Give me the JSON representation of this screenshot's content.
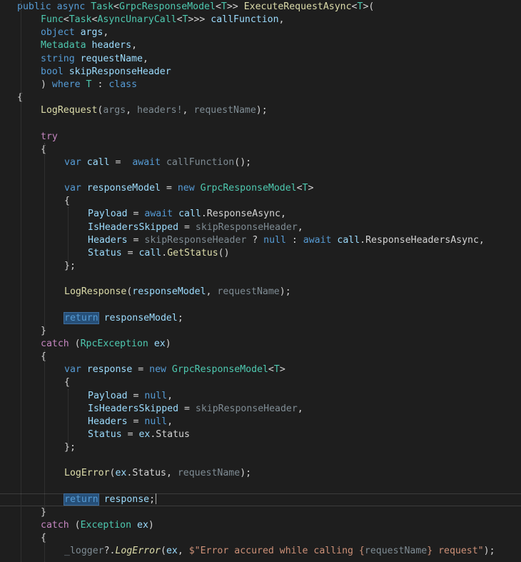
{
  "colors": {
    "background": "#1e1e1e",
    "keyword": "#569cd6",
    "control": "#c586c0",
    "type": "#4ec9b0",
    "method": "#dcdcaa",
    "variable": "#9cdcfe",
    "param_faded": "#7f8c94",
    "text": "#d4d4d4",
    "string": "#ce9178",
    "selection": "#264f78"
  },
  "lines": [
    {
      "indent": 0,
      "tokens": [
        [
          "public",
          "keyword"
        ],
        [
          " ",
          ""
        ],
        [
          "async",
          "keyword"
        ],
        [
          " ",
          ""
        ],
        [
          "Task",
          "type"
        ],
        [
          "<",
          ""
        ],
        [
          "GrpcResponseModel",
          "type"
        ],
        [
          "<",
          ""
        ],
        [
          "T",
          "type"
        ],
        [
          ">> ",
          ""
        ],
        [
          "ExecuteRequestAsync",
          "method"
        ],
        [
          "<",
          ""
        ],
        [
          "T",
          "type"
        ],
        [
          ">(",
          ""
        ]
      ]
    },
    {
      "indent": 1,
      "tokens": [
        [
          "Func",
          "type"
        ],
        [
          "<",
          ""
        ],
        [
          "Task",
          "type"
        ],
        [
          "<",
          ""
        ],
        [
          "AsyncUnaryCall",
          "type"
        ],
        [
          "<",
          ""
        ],
        [
          "T",
          "type"
        ],
        [
          ">>> ",
          ""
        ],
        [
          "callFunction",
          "variable"
        ],
        [
          ",",
          ""
        ]
      ]
    },
    {
      "indent": 1,
      "tokens": [
        [
          "object",
          "keyword"
        ],
        [
          " ",
          ""
        ],
        [
          "args",
          "variable"
        ],
        [
          ",",
          ""
        ]
      ]
    },
    {
      "indent": 1,
      "tokens": [
        [
          "Metadata",
          "type"
        ],
        [
          " ",
          ""
        ],
        [
          "headers",
          "variable"
        ],
        [
          ",",
          ""
        ]
      ]
    },
    {
      "indent": 1,
      "tokens": [
        [
          "string",
          "keyword"
        ],
        [
          " ",
          ""
        ],
        [
          "requestName",
          "variable"
        ],
        [
          ",",
          ""
        ]
      ]
    },
    {
      "indent": 1,
      "tokens": [
        [
          "bool",
          "keyword"
        ],
        [
          " ",
          ""
        ],
        [
          "skipResponseHeader",
          "variable"
        ]
      ]
    },
    {
      "indent": 1,
      "tokens": [
        [
          ") ",
          ""
        ],
        [
          "where",
          "keyword"
        ],
        [
          " ",
          ""
        ],
        [
          "T",
          "type"
        ],
        [
          " : ",
          ""
        ],
        [
          "class",
          "keyword"
        ]
      ]
    },
    {
      "indent": 0,
      "tokens": [
        [
          "{",
          ""
        ]
      ]
    },
    {
      "indent": 1,
      "tokens": [
        [
          "LogRequest",
          "method"
        ],
        [
          "(",
          ""
        ],
        [
          "args",
          "param_faded"
        ],
        [
          ", ",
          ""
        ],
        [
          "headers!",
          "param_faded"
        ],
        [
          ", ",
          ""
        ],
        [
          "requestName",
          "param_faded"
        ],
        [
          ");",
          ""
        ]
      ]
    },
    {
      "indent": 0,
      "tokens": []
    },
    {
      "indent": 1,
      "tokens": [
        [
          "try",
          "control"
        ]
      ]
    },
    {
      "indent": 1,
      "tokens": [
        [
          "{",
          ""
        ]
      ]
    },
    {
      "indent": 2,
      "tokens": [
        [
          "var",
          "keyword"
        ],
        [
          " ",
          ""
        ],
        [
          "call",
          "variable"
        ],
        [
          " =  ",
          ""
        ],
        [
          "await",
          "keyword"
        ],
        [
          " ",
          ""
        ],
        [
          "callFunction",
          "param_faded"
        ],
        [
          "();",
          ""
        ]
      ]
    },
    {
      "indent": 0,
      "tokens": []
    },
    {
      "indent": 2,
      "tokens": [
        [
          "var",
          "keyword"
        ],
        [
          " ",
          ""
        ],
        [
          "responseModel",
          "variable"
        ],
        [
          " = ",
          ""
        ],
        [
          "new",
          "keyword"
        ],
        [
          " ",
          ""
        ],
        [
          "GrpcResponseModel",
          "type"
        ],
        [
          "<",
          ""
        ],
        [
          "T",
          "type"
        ],
        [
          ">",
          ""
        ]
      ]
    },
    {
      "indent": 2,
      "tokens": [
        [
          "{",
          ""
        ]
      ]
    },
    {
      "indent": 3,
      "tokens": [
        [
          "Payload",
          "variable"
        ],
        [
          " = ",
          ""
        ],
        [
          "await",
          "keyword"
        ],
        [
          " ",
          ""
        ],
        [
          "call",
          "variable"
        ],
        [
          ".ResponseAsync,",
          ""
        ]
      ]
    },
    {
      "indent": 3,
      "tokens": [
        [
          "IsHeadersSkipped",
          "variable"
        ],
        [
          " = ",
          ""
        ],
        [
          "skipResponseHeader",
          "param_faded"
        ],
        [
          ",",
          ""
        ]
      ]
    },
    {
      "indent": 3,
      "tokens": [
        [
          "Headers",
          "variable"
        ],
        [
          " = ",
          ""
        ],
        [
          "skipResponseHeader",
          "param_faded"
        ],
        [
          " ? ",
          ""
        ],
        [
          "null",
          "keyword"
        ],
        [
          " : ",
          ""
        ],
        [
          "await",
          "keyword"
        ],
        [
          " ",
          ""
        ],
        [
          "call",
          "variable"
        ],
        [
          ".ResponseHeadersAsync,",
          ""
        ]
      ]
    },
    {
      "indent": 3,
      "tokens": [
        [
          "Status",
          "variable"
        ],
        [
          " = ",
          ""
        ],
        [
          "call",
          "variable"
        ],
        [
          ".",
          ""
        ],
        [
          "GetStatus",
          "method"
        ],
        [
          "()",
          ""
        ]
      ]
    },
    {
      "indent": 2,
      "tokens": [
        [
          "};",
          ""
        ]
      ]
    },
    {
      "indent": 0,
      "tokens": []
    },
    {
      "indent": 2,
      "tokens": [
        [
          "LogResponse",
          "method"
        ],
        [
          "(",
          ""
        ],
        [
          "responseModel",
          "variable"
        ],
        [
          ", ",
          ""
        ],
        [
          "requestName",
          "param_faded"
        ],
        [
          ");",
          ""
        ]
      ]
    },
    {
      "indent": 0,
      "tokens": []
    },
    {
      "indent": 2,
      "tokens": [
        [
          "return",
          "control_hl"
        ],
        [
          " ",
          ""
        ],
        [
          "responseModel",
          "variable"
        ],
        [
          ";",
          ""
        ]
      ]
    },
    {
      "indent": 1,
      "tokens": [
        [
          "}",
          ""
        ]
      ]
    },
    {
      "indent": 1,
      "tokens": [
        [
          "catch",
          "control"
        ],
        [
          " (",
          ""
        ],
        [
          "RpcException",
          "type"
        ],
        [
          " ",
          ""
        ],
        [
          "ex",
          "variable"
        ],
        [
          ")",
          ""
        ]
      ]
    },
    {
      "indent": 1,
      "tokens": [
        [
          "{",
          ""
        ]
      ]
    },
    {
      "indent": 2,
      "tokens": [
        [
          "var",
          "keyword"
        ],
        [
          " ",
          ""
        ],
        [
          "response",
          "variable"
        ],
        [
          " = ",
          ""
        ],
        [
          "new",
          "keyword"
        ],
        [
          " ",
          ""
        ],
        [
          "GrpcResponseModel",
          "type"
        ],
        [
          "<",
          ""
        ],
        [
          "T",
          "type"
        ],
        [
          ">",
          ""
        ]
      ]
    },
    {
      "indent": 2,
      "tokens": [
        [
          "{",
          ""
        ]
      ]
    },
    {
      "indent": 3,
      "tokens": [
        [
          "Payload",
          "variable"
        ],
        [
          " = ",
          ""
        ],
        [
          "null",
          "keyword"
        ],
        [
          ",",
          ""
        ]
      ]
    },
    {
      "indent": 3,
      "tokens": [
        [
          "IsHeadersSkipped",
          "variable"
        ],
        [
          " = ",
          ""
        ],
        [
          "skipResponseHeader",
          "param_faded"
        ],
        [
          ",",
          ""
        ]
      ]
    },
    {
      "indent": 3,
      "tokens": [
        [
          "Headers",
          "variable"
        ],
        [
          " = ",
          ""
        ],
        [
          "null",
          "keyword"
        ],
        [
          ",",
          ""
        ]
      ]
    },
    {
      "indent": 3,
      "tokens": [
        [
          "Status",
          "variable"
        ],
        [
          " = ",
          ""
        ],
        [
          "ex",
          "variable"
        ],
        [
          ".Status",
          ""
        ]
      ]
    },
    {
      "indent": 2,
      "tokens": [
        [
          "};",
          ""
        ]
      ]
    },
    {
      "indent": 0,
      "tokens": []
    },
    {
      "indent": 2,
      "tokens": [
        [
          "LogError",
          "method"
        ],
        [
          "(",
          ""
        ],
        [
          "ex",
          "variable"
        ],
        [
          ".Status, ",
          ""
        ],
        [
          "requestName",
          "param_faded"
        ],
        [
          ");",
          ""
        ]
      ]
    },
    {
      "indent": 0,
      "tokens": []
    },
    {
      "indent": 2,
      "current": true,
      "tokens": [
        [
          "return",
          "control_hl"
        ],
        [
          " ",
          ""
        ],
        [
          "response",
          "variable"
        ],
        [
          ";",
          ""
        ]
      ]
    },
    {
      "indent": 1,
      "tokens": [
        [
          "}",
          ""
        ]
      ]
    },
    {
      "indent": 1,
      "tokens": [
        [
          "catch",
          "control"
        ],
        [
          " (",
          ""
        ],
        [
          "Exception",
          "type"
        ],
        [
          " ",
          ""
        ],
        [
          "ex",
          "variable"
        ],
        [
          ")",
          ""
        ]
      ]
    },
    {
      "indent": 1,
      "tokens": [
        [
          "{",
          ""
        ]
      ]
    },
    {
      "indent": 2,
      "tokens": [
        [
          "_logger",
          "param_faded"
        ],
        [
          "?.",
          ""
        ],
        [
          "LogError",
          "method_italic"
        ],
        [
          "(",
          ""
        ],
        [
          "ex",
          "variable"
        ],
        [
          ", ",
          ""
        ],
        [
          "$\"Error accured while calling {",
          ""
        ],
        [
          "requestName",
          "param_faded"
        ],
        [
          "} request\"",
          ""
        ],
        [
          ");",
          ""
        ]
      ]
    }
  ]
}
